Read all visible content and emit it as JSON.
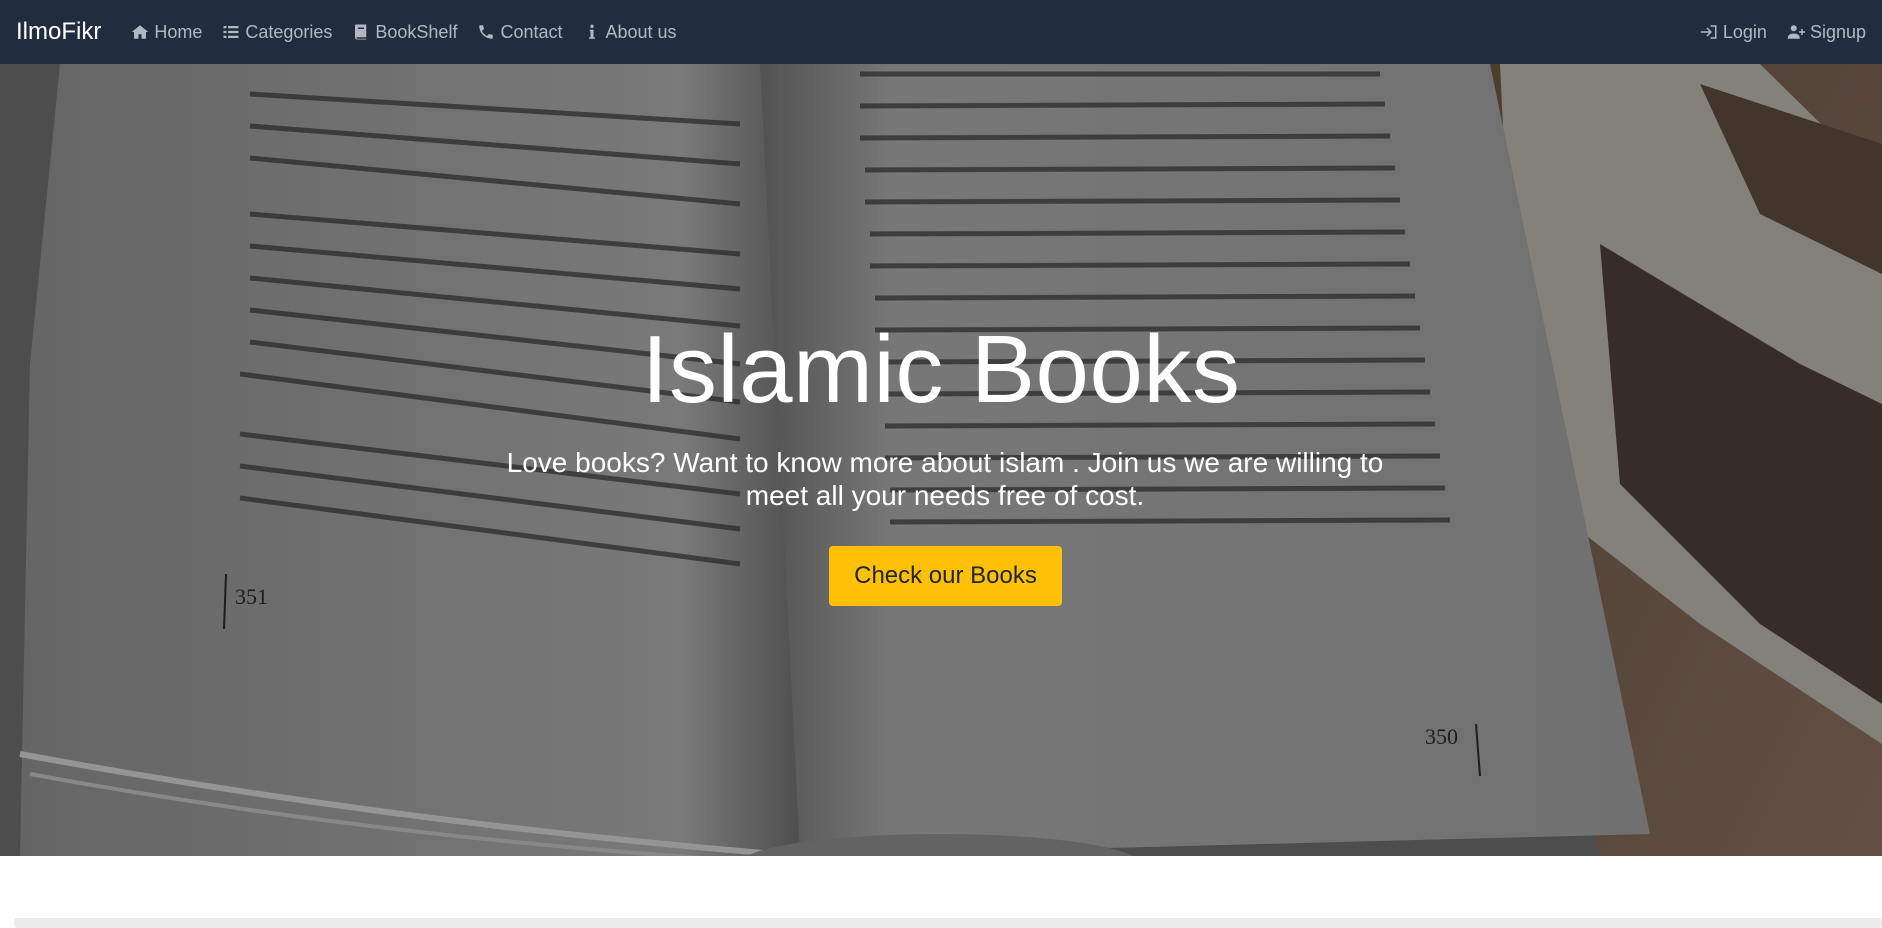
{
  "navbar": {
    "brand": "IlmoFikr",
    "left_links": [
      {
        "label": "Home",
        "icon": "home-icon"
      },
      {
        "label": "Categories",
        "icon": "list-icon"
      },
      {
        "label": "BookShelf",
        "icon": "book-icon"
      },
      {
        "label": "Contact",
        "icon": "phone-icon"
      },
      {
        "label": "About us",
        "icon": "info-icon"
      }
    ],
    "right_links": [
      {
        "label": "Login",
        "icon": "sign-in-icon"
      },
      {
        "label": "Signup",
        "icon": "user-plus-icon"
      }
    ],
    "colors": {
      "background": "#212d3f",
      "link": "#b3b8c0",
      "brand": "#ffffff"
    }
  },
  "hero": {
    "title": "Islamic Books",
    "subtitle": "Love books? Want to know more about islam . Join us we are willing to meet all your needs free of cost.",
    "cta_label": "Check our Books",
    "cta_color": "#ffc107",
    "background_image": "open-book-photo",
    "page_numbers": {
      "left": "351",
      "right": "350"
    }
  }
}
